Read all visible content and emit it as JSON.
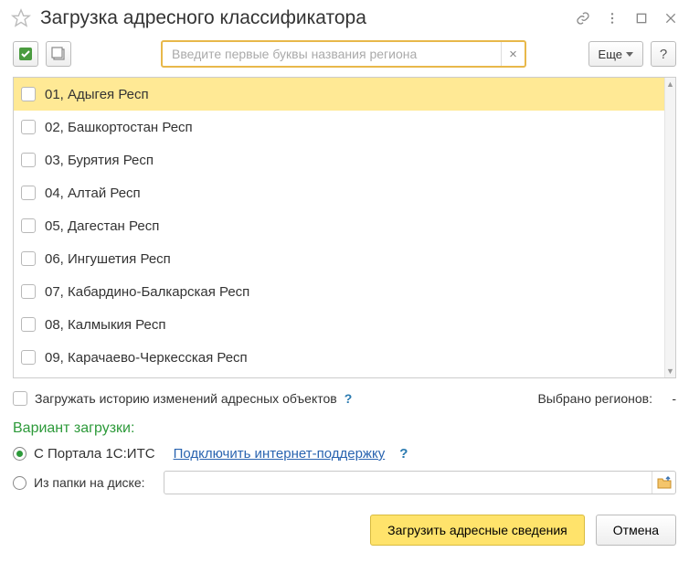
{
  "title": "Загрузка адресного классификатора",
  "search": {
    "placeholder": "Введите первые буквы названия региона"
  },
  "more_label": "Еще",
  "regions": [
    "01, Адыгея Респ",
    "02, Башкортостан Респ",
    "03, Бурятия Респ",
    "04, Алтай Респ",
    "05, Дагестан Респ",
    "06, Ингушетия Респ",
    "07, Кабардино-Балкарская Респ",
    "08, Калмыкия Респ",
    "09, Карачаево-Черкесская Респ"
  ],
  "history_label": "Загружать историю изменений адресных объектов",
  "selected_label": "Выбрано регионов:",
  "selected_value": "-",
  "variant_title": "Вариант загрузки:",
  "portal_label": "С Портала 1С:ИТС",
  "connect_link": "Подключить интернет-поддержку",
  "folder_label": "Из папки на диске:",
  "btn_load": "Загрузить адресные сведения",
  "btn_cancel": "Отмена"
}
